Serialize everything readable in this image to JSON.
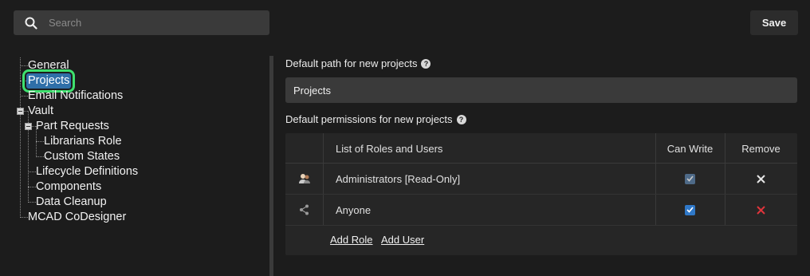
{
  "search": {
    "placeholder": "Search",
    "value": ""
  },
  "toolbar": {
    "save_label": "Save"
  },
  "tree": {
    "general": "General",
    "projects": "Projects",
    "email_notifications": "Email Notifications",
    "vault": "Vault",
    "part_requests": "Part Requests",
    "librarians_role": "Librarians Role",
    "custom_states": "Custom States",
    "lifecycle_definitions": "Lifecycle Definitions",
    "components": "Components",
    "data_cleanup": "Data Cleanup",
    "mcad_codesigner": "MCAD CoDesigner"
  },
  "settings": {
    "default_path_label": "Default path for new projects",
    "default_path_value": "Projects",
    "default_permissions_label": "Default permissions for new projects",
    "help_glyph": "?"
  },
  "permissions_table": {
    "columns": {
      "roles": "List of Roles and Users",
      "can_write": "Can Write",
      "remove": "Remove"
    },
    "rows": [
      {
        "icon": "user-group-icon",
        "name": "Administrators [Read-Only]",
        "can_write": true,
        "can_write_disabled": true,
        "remove_color": "#e6e6e6"
      },
      {
        "icon": "share-icon",
        "name": "Anyone",
        "can_write": true,
        "can_write_disabled": false,
        "remove_color": "#e0343b"
      }
    ],
    "add_role": "Add Role",
    "add_user": "Add User"
  },
  "colors": {
    "accent_blue": "#2f6fa8",
    "highlight_green": "#3ee06e",
    "checkbox_blue": "#2f78c8",
    "remove_red": "#e0343b"
  }
}
